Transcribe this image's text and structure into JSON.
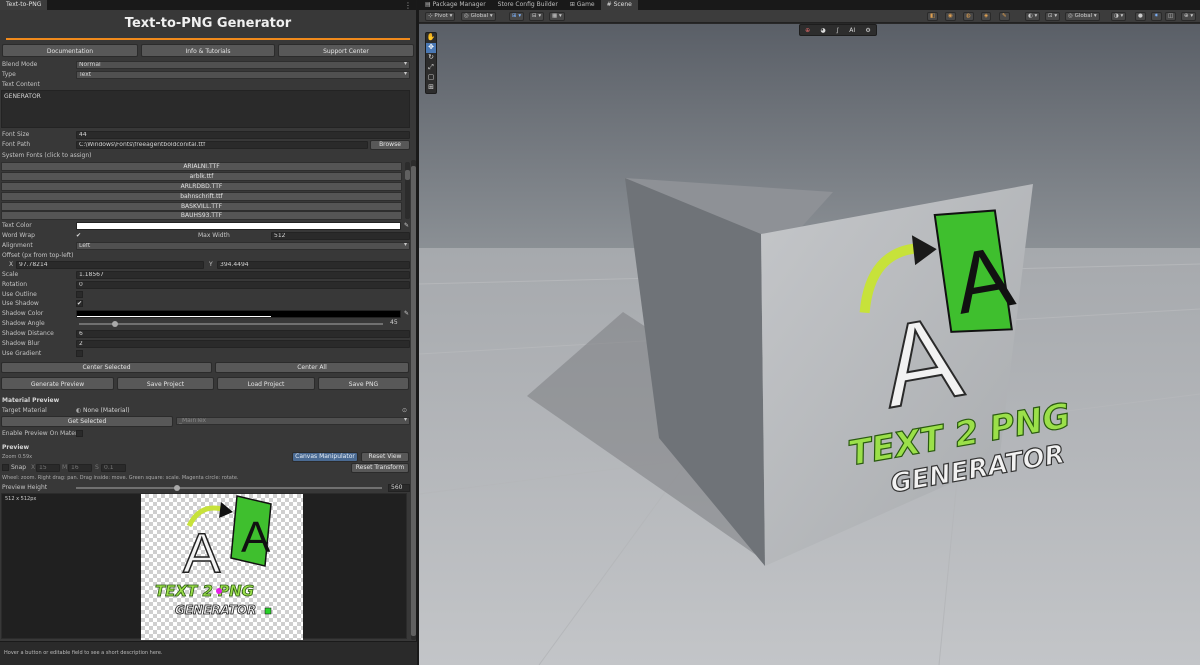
{
  "left_tab": "Text-to-PNG",
  "app_title": "Text-to-PNG Generator",
  "top_buttons": [
    "Documentation",
    "Info & Tutorials",
    "Support Center"
  ],
  "blend_mode": {
    "label": "Blend Mode",
    "value": "Normal"
  },
  "type": {
    "label": "Type",
    "value": "Text"
  },
  "text_content": {
    "label": "Text Content",
    "value": "GENERATOR"
  },
  "font_size": {
    "label": "Font Size",
    "value": "44"
  },
  "font_path": {
    "label": "Font Path",
    "value": "C:\\Windows\\Fonts\\freeagentboldconital.ttf",
    "browse": "Browse"
  },
  "system_fonts": {
    "label": "System Fonts (click to assign)",
    "items": [
      "ARIALNI.TTF",
      "arblk.ttf",
      "ARLRDBD.TTF",
      "bahnschrift.ttf",
      "BASKVILL.TTF",
      "BAUHS93.TTF"
    ]
  },
  "text_color": {
    "label": "Text Color",
    "color": "#ffffff"
  },
  "word_wrap": {
    "label": "Word Wrap",
    "checked": "✔",
    "max_width_label": "Max Width",
    "max_width": "512"
  },
  "alignment": {
    "label": "Alignment",
    "value": "Left"
  },
  "offset": {
    "label": "Offset (px from top-left)",
    "x_label": "X",
    "x": "97.78214",
    "y_label": "Y",
    "y": "394.4494"
  },
  "scale": {
    "label": "Scale",
    "value": "1.18567"
  },
  "rotation": {
    "label": "Rotation",
    "value": "0"
  },
  "use_outline": {
    "label": "Use Outline"
  },
  "use_shadow": {
    "label": "Use Shadow",
    "checked": "✔"
  },
  "shadow_color": {
    "label": "Shadow Color",
    "color": "#000000"
  },
  "shadow_angle": {
    "label": "Shadow Angle",
    "value": "45",
    "fraction": 0.12
  },
  "shadow_distance": {
    "label": "Shadow Distance",
    "value": "6"
  },
  "shadow_blur": {
    "label": "Shadow Blur",
    "value": "2"
  },
  "use_gradient": {
    "label": "Use Gradient"
  },
  "center_buttons": [
    "Center Selected",
    "Center All"
  ],
  "action_buttons": [
    "Generate Preview",
    "Save Project",
    "Load Project",
    "Save PNG"
  ],
  "material_preview": {
    "heading": "Material Preview",
    "target_label": "Target Material",
    "target_value": "None (Material)",
    "get_selected": "Get Selected",
    "maintex": "_MainTex",
    "enable_label": "Enable Preview On Materi"
  },
  "preview": {
    "heading": "Preview",
    "zoom": "Zoom 0.59x",
    "canvas_manipulator": "Canvas Manipulator",
    "reset_view": "Reset View",
    "snap": "Snap",
    "snap_x_label": "X",
    "snap_x": "15",
    "snap_m_label": "M",
    "snap_m": "16",
    "snap_s_label": "S",
    "snap_s": "0.1",
    "reset_transform": "Reset Transform",
    "hint": "Wheel: zoom. Right drag: pan. Drag inside: move. Green square: scale. Magenta circle: rotate.",
    "height_label": "Preview Height",
    "height_value": "560",
    "height_fraction": 0.33,
    "size_label": "512 x 512px"
  },
  "status_text": "Hover a button or editable field to see a short description here.",
  "scene_tabs": [
    "Package Manager",
    "Store Config Builder",
    "Game",
    "Scene"
  ],
  "scene_toolbar": {
    "pivot": "Pivot",
    "global": "Global",
    "global2": "Global"
  },
  "scene_overlay_icons": [
    "ai-icon"
  ],
  "logo_text": {
    "line1": "TEXT 2 PNG",
    "line2": "GENERATOR",
    "big_a": "A",
    "small_a": "A"
  },
  "colors": {
    "accent": "#f08a1c",
    "green": "#5cc13a",
    "logo_green": "#a6d63a"
  }
}
